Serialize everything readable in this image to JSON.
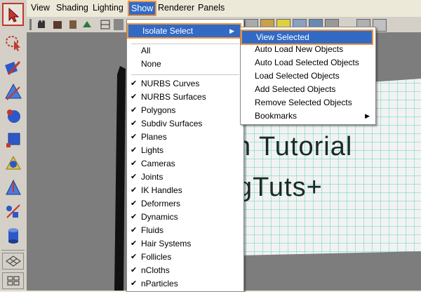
{
  "menubar": {
    "items": [
      "View",
      "Shading",
      "Lighting",
      "Show",
      "Renderer",
      "Panels"
    ]
  },
  "viewport": {
    "text_line1": "h Tutorial",
    "text_line2": "gTuts+"
  },
  "show_menu": {
    "isolate_select": "Isolate Select",
    "all": "All",
    "none": "None",
    "items": [
      "NURBS Curves",
      "NURBS Surfaces",
      "Polygons",
      "Subdiv Surfaces",
      "Planes",
      "Lights",
      "Cameras",
      "Joints",
      "IK Handles",
      "Deformers",
      "Dynamics",
      "Fluids",
      "Hair Systems",
      "Follicles",
      "nCloths",
      "nParticles"
    ],
    "check": "✔"
  },
  "isolate_submenu": {
    "items": [
      "View Selected",
      "Auto Load New Objects",
      "Auto Load Selected Objects",
      "Load Selected Objects",
      "Add Selected Objects",
      "Remove Selected Objects",
      "Bookmarks"
    ]
  },
  "colors": {
    "highlight": "#316ac5",
    "highlight_border": "#f0923a",
    "grid": "#55d6bd"
  }
}
